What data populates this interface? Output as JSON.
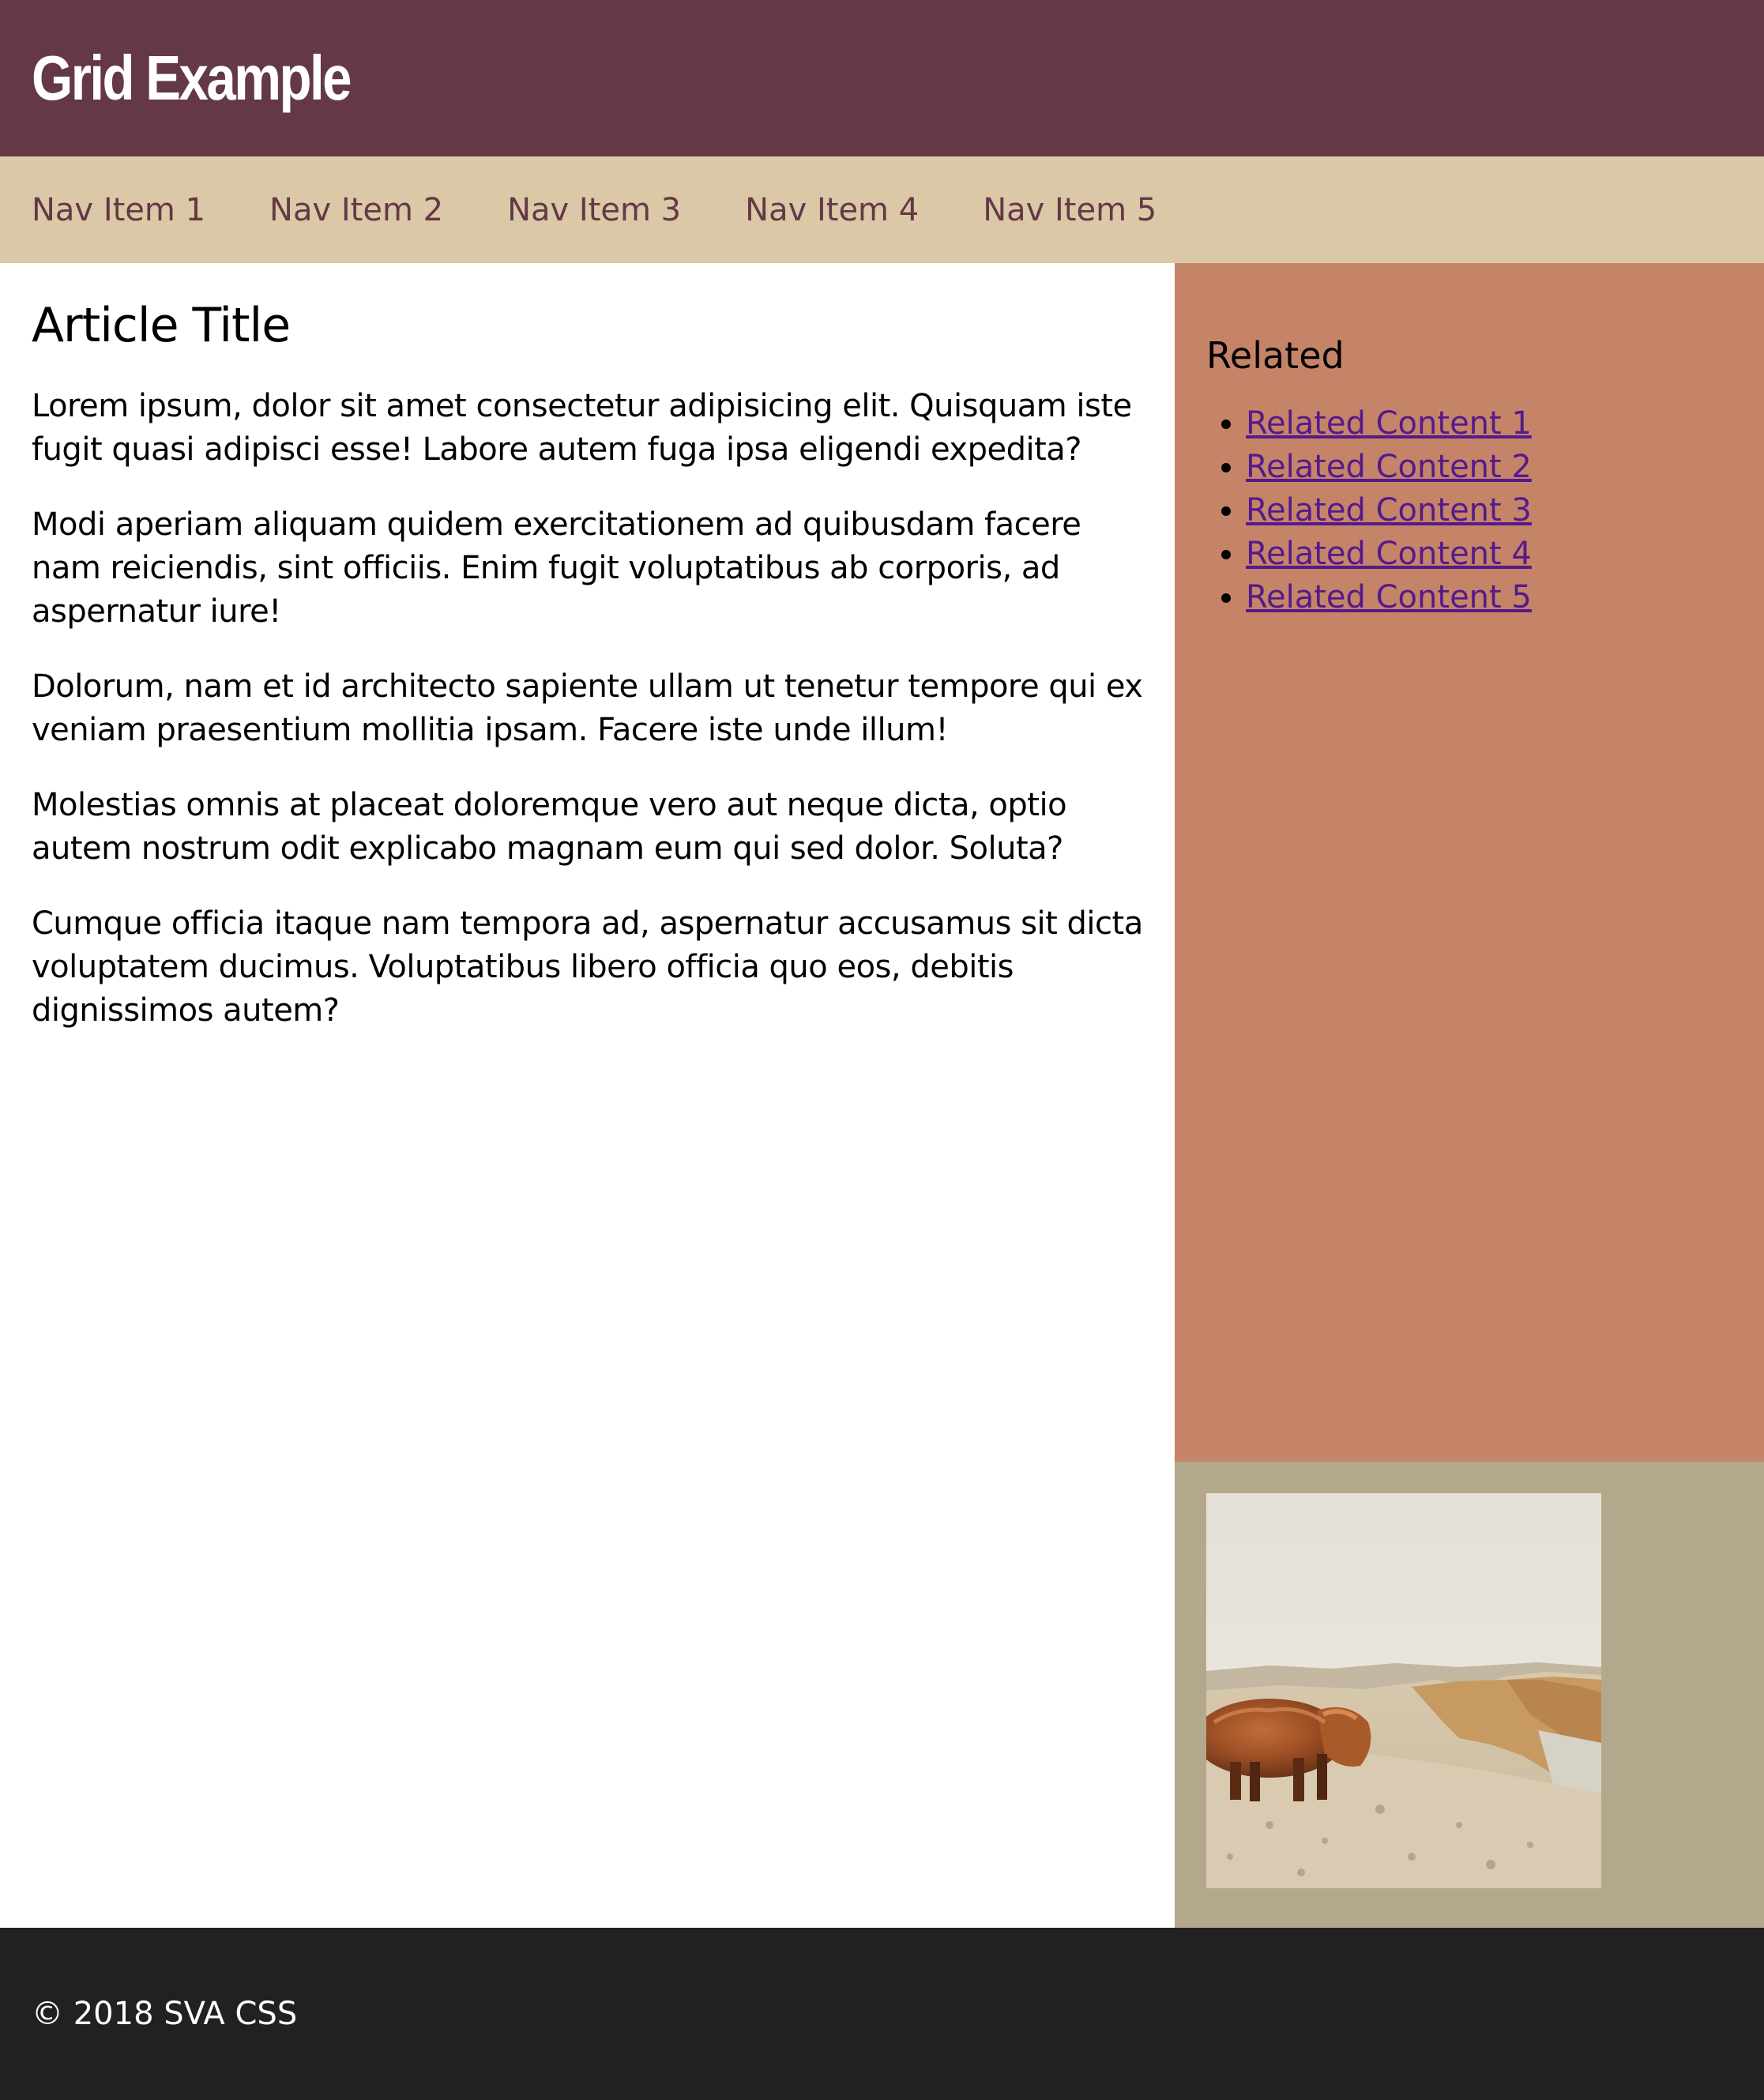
{
  "header": {
    "title": "Grid Example"
  },
  "nav": {
    "items": [
      "Nav Item 1",
      "Nav Item 2",
      "Nav Item 3",
      "Nav Item 4",
      "Nav Item 5"
    ]
  },
  "article": {
    "title": "Article Title",
    "paragraphs": [
      "Lorem ipsum, dolor sit amet consectetur adipisicing elit. Quisquam iste fugit quasi adipisci esse! Labore autem fuga ipsa eligendi expedita?",
      "Modi aperiam aliquam quidem exercitationem ad quibusdam facere nam reiciendis, sint officiis. Enim fugit voluptatibus ab corporis, ad aspernatur iure!",
      "Dolorum, nam et id architecto sapiente ullam ut tenetur tempore qui ex veniam praesentium mollitia ipsam. Facere iste unde illum!",
      "Molestias omnis at placeat doloremque vero aut neque dicta, optio autem nostrum odit explicabo magnam eum qui sed dolor. Soluta?",
      "Cumque officia itaque nam tempora ad, aspernatur accusamus sit dicta voluptatem ducimus. Voluptatibus libero officia quo eos, debitis dignissimos autem?"
    ]
  },
  "related": {
    "heading": "Related",
    "links": [
      "Related Content 1",
      "Related Content 2",
      "Related Content 3",
      "Related Content 4",
      "Related Content 5"
    ]
  },
  "footer": {
    "copyright": "© 2018 SVA CSS"
  },
  "colors": {
    "header_bg": "#643847",
    "nav_bg": "#dac8a6",
    "nav_text": "#643847",
    "sidebar_bg": "#c58468",
    "photo_panel_bg": "#b4a88c",
    "footer_bg": "#212121",
    "link": "#551a8b"
  }
}
